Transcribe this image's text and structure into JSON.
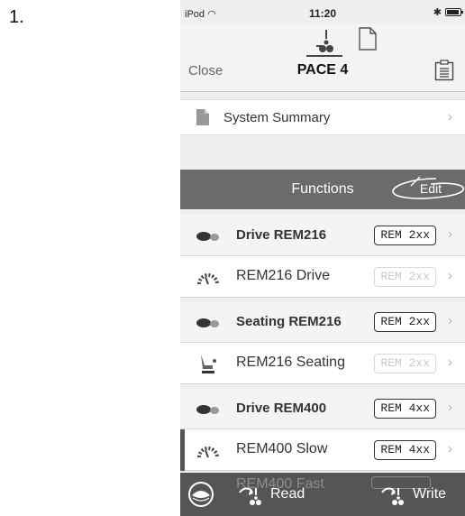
{
  "step_label": "1.",
  "status_bar": {
    "carrier": "iPod",
    "time": "11:20",
    "battery_level": 0.8
  },
  "nav": {
    "close_label": "Close",
    "title": "PACE 4",
    "tabs": [
      "drive-tab",
      "document-tab"
    ]
  },
  "system_summary": {
    "label": "System Summary"
  },
  "functions": {
    "header": "Functions",
    "edit_label": "Edit"
  },
  "rows": [
    {
      "label": "Drive REM216",
      "badge": "REM 2xx",
      "group": true,
      "badge_faded": false,
      "icon": "toggle-icon"
    },
    {
      "label": "REM216 Drive",
      "badge": "REM 2xx",
      "group": false,
      "badge_faded": true,
      "icon": "speedometer-icon"
    },
    {
      "label": "Seating REM216",
      "badge": "REM 2xx",
      "group": true,
      "badge_faded": false,
      "icon": "toggle-icon"
    },
    {
      "label": "REM216 Seating",
      "badge": "REM 2xx",
      "group": false,
      "badge_faded": true,
      "icon": "seat-icon"
    },
    {
      "label": "Drive REM400",
      "badge": "REM 4xx",
      "group": true,
      "badge_faded": false,
      "icon": "toggle-icon"
    },
    {
      "label": "REM400 Slow",
      "badge": "REM 4xx",
      "group": false,
      "badge_faded": false,
      "icon": "speedometer-icon",
      "active": true
    }
  ],
  "next_row_peek": "REM400 Fast",
  "toolbar": {
    "read_label": "Read",
    "write_label": "Write"
  },
  "colors": {
    "header_bar": "#6b6b6b",
    "toolbar": "#555555",
    "background": "#efefef"
  }
}
